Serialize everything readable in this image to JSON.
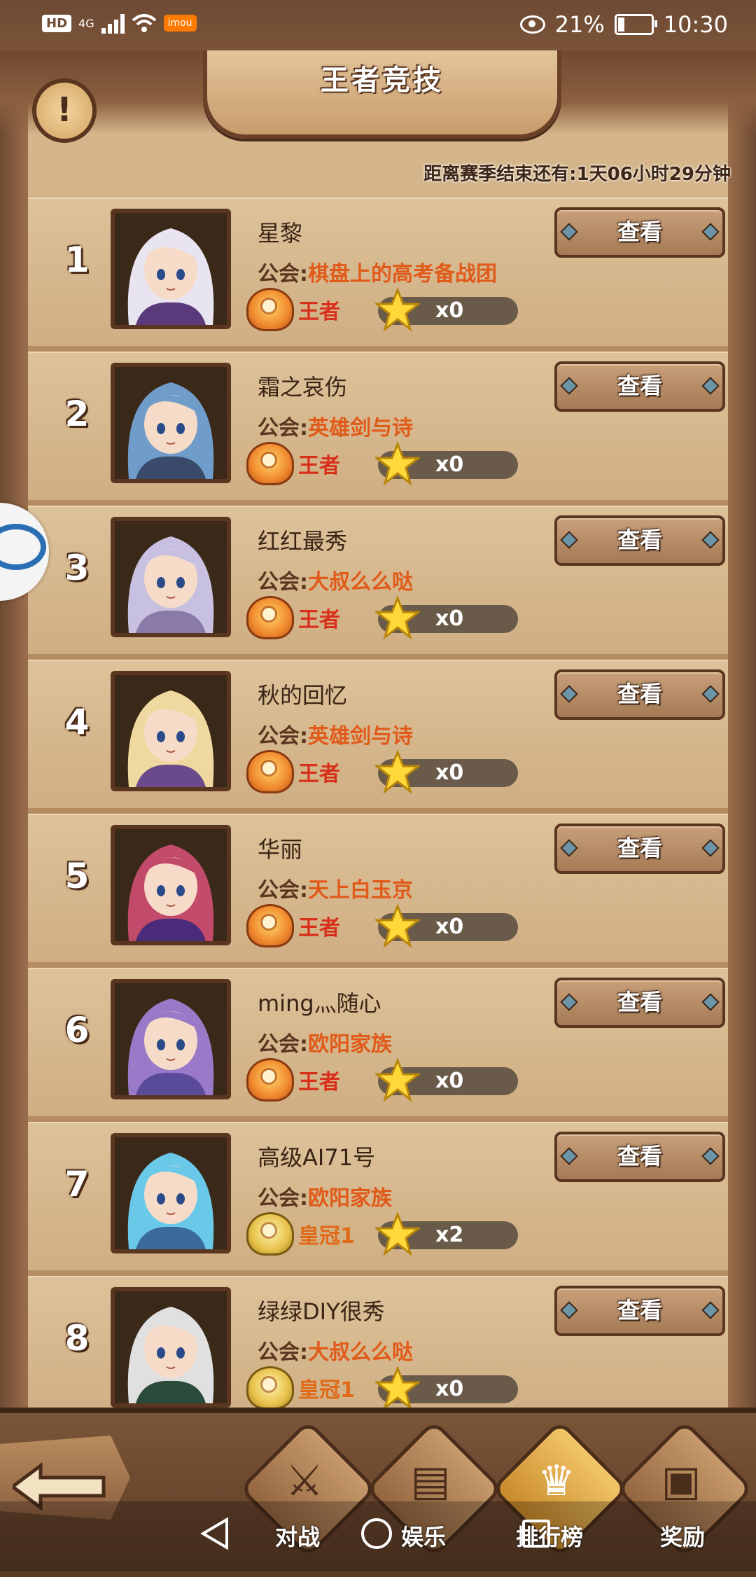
{
  "status_bar": {
    "hd": "HD",
    "network": "4G",
    "app_badge": "imou",
    "battery": "21%",
    "time": "10:30"
  },
  "header": {
    "title": "王者竞技",
    "alert_symbol": "!",
    "season_label": "距离赛季结束还有:",
    "season_time": "1天06小时29分钟"
  },
  "guild_label": "公会:",
  "view_label": "查看",
  "players": [
    {
      "rank": "1",
      "name": "星黎",
      "guild": "棋盘上的高考备战团",
      "tier": "王者",
      "stars": "x0",
      "tier_type": "king",
      "hair": "#e8e4f0",
      "outfit": "#5a3a7a"
    },
    {
      "rank": "2",
      "name": "霜之哀伤",
      "guild": "英雄剑与诗",
      "tier": "王者",
      "stars": "x0",
      "tier_type": "king",
      "hair": "#6f9cc9",
      "outfit": "#3a4a6a"
    },
    {
      "rank": "3",
      "name": "红红最秀",
      "guild": "大叔么么哒",
      "tier": "王者",
      "stars": "x0",
      "tier_type": "king",
      "hair": "#c8c0e0",
      "outfit": "#8a7aa8"
    },
    {
      "rank": "4",
      "name": "秋的回忆",
      "guild": "英雄剑与诗",
      "tier": "王者",
      "stars": "x0",
      "tier_type": "king",
      "hair": "#f0d9a0",
      "outfit": "#6a4a8a"
    },
    {
      "rank": "5",
      "name": "华丽",
      "guild": "天上白玉京",
      "tier": "王者",
      "stars": "x0",
      "tier_type": "king",
      "hair": "#c24a6a",
      "outfit": "#4a2a7a"
    },
    {
      "rank": "6",
      "name": "ming灬随心",
      "guild": "欧阳家族",
      "tier": "王者",
      "stars": "x0",
      "tier_type": "king",
      "hair": "#9a7ac8",
      "outfit": "#5a4a9a"
    },
    {
      "rank": "7",
      "name": "高级AI71号",
      "guild": "欧阳家族",
      "tier": "皇冠1",
      "stars": "x2",
      "tier_type": "crown",
      "hair": "#6ac8e8",
      "outfit": "#3a6a9a"
    },
    {
      "rank": "8",
      "name": "绿绿DIY很秀",
      "guild": "大叔么么哒",
      "tier": "皇冠1",
      "stars": "x0",
      "tier_type": "crown",
      "hair": "#e0e0e0",
      "outfit": "#2a4a3a"
    }
  ],
  "bottom_nav": {
    "battle": "对战",
    "entertainment": "娱乐",
    "ranking": "排行榜",
    "rewards": "奖励"
  },
  "colors": {
    "parchment": "#cba67a",
    "frame": "#5a3620",
    "guild_name": "#e05a1a",
    "tier_king": "#d8301a"
  }
}
